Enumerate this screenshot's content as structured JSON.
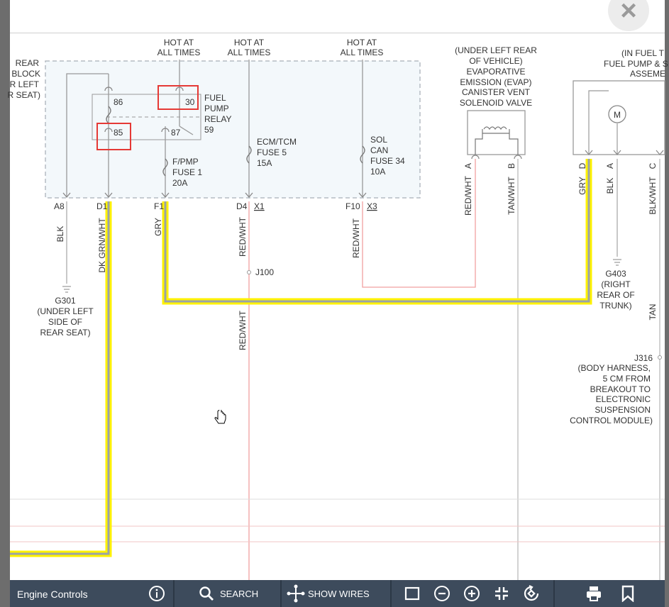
{
  "close_icon": "×",
  "left_block": {
    "title_lines": [
      "REAR",
      "BLOCK",
      "R LEFT",
      "R SEAT)"
    ]
  },
  "hot_labels": [
    "HOT AT",
    "ALL TIMES"
  ],
  "relay": {
    "pin86": "86",
    "pin30": "30",
    "pin85": "85",
    "pin87": "87",
    "label_lines": [
      "FUEL",
      "PUMP",
      "RELAY",
      "59"
    ]
  },
  "fuse_fpmp": [
    "F/PMP",
    "FUSE 1",
    "20A"
  ],
  "fuse_ecm": [
    "ECM/TCM",
    "FUSE 5",
    "15A"
  ],
  "fuse_sol": [
    "SOL",
    "CAN",
    "FUSE 34",
    "10A"
  ],
  "pins": {
    "a8": "A8",
    "d1": "D1",
    "f1": "F1",
    "d4": "D4",
    "x1": "X1",
    "f10": "F10",
    "x3": "X3"
  },
  "wires": {
    "blk": "BLK",
    "dkgrn": "DK GRN/WHT",
    "gry": "GRY",
    "redwht": "RED/WHT",
    "tanwht": "TAN/WHT",
    "blkwht": "BLK/WHT",
    "tan": "TAN"
  },
  "g301": [
    "G301",
    "(UNDER LEFT",
    "SIDE OF",
    "REAR SEAT)"
  ],
  "j100": "J100",
  "evap": {
    "lines": [
      "(UNDER LEFT REAR",
      "OF VEHICLE)",
      "EVAPORATIVE",
      "EMISSION (EVAP)",
      "CANISTER VENT",
      "SOLENOID VALVE"
    ],
    "pin_a": "A",
    "pin_b": "B"
  },
  "pump": {
    "lines": [
      "(IN FUEL T",
      "FUEL PUMP & S",
      "ASSEME"
    ],
    "motor": "M",
    "pin_d": "D",
    "pin_a": "A",
    "pin_c": "C"
  },
  "g403": [
    "G403",
    "(RIGHT",
    "REAR OF",
    "TRUNK)"
  ],
  "j316": [
    "J316",
    "(BODY HARNESS,",
    "5 CM FROM",
    "BREAKOUT TO",
    "ELECTRONIC",
    "SUSPENSION",
    "CONTROL MODULE)"
  ],
  "toolbar": {
    "title": "Engine Controls",
    "search": "SEARCH",
    "show_wires": "SHOW WIRES"
  },
  "colors": {
    "highlight": "#fff200",
    "toolbar": "#3d4b5c",
    "relay_box": "#e53935",
    "red_wire": "#f0a0a0"
  }
}
